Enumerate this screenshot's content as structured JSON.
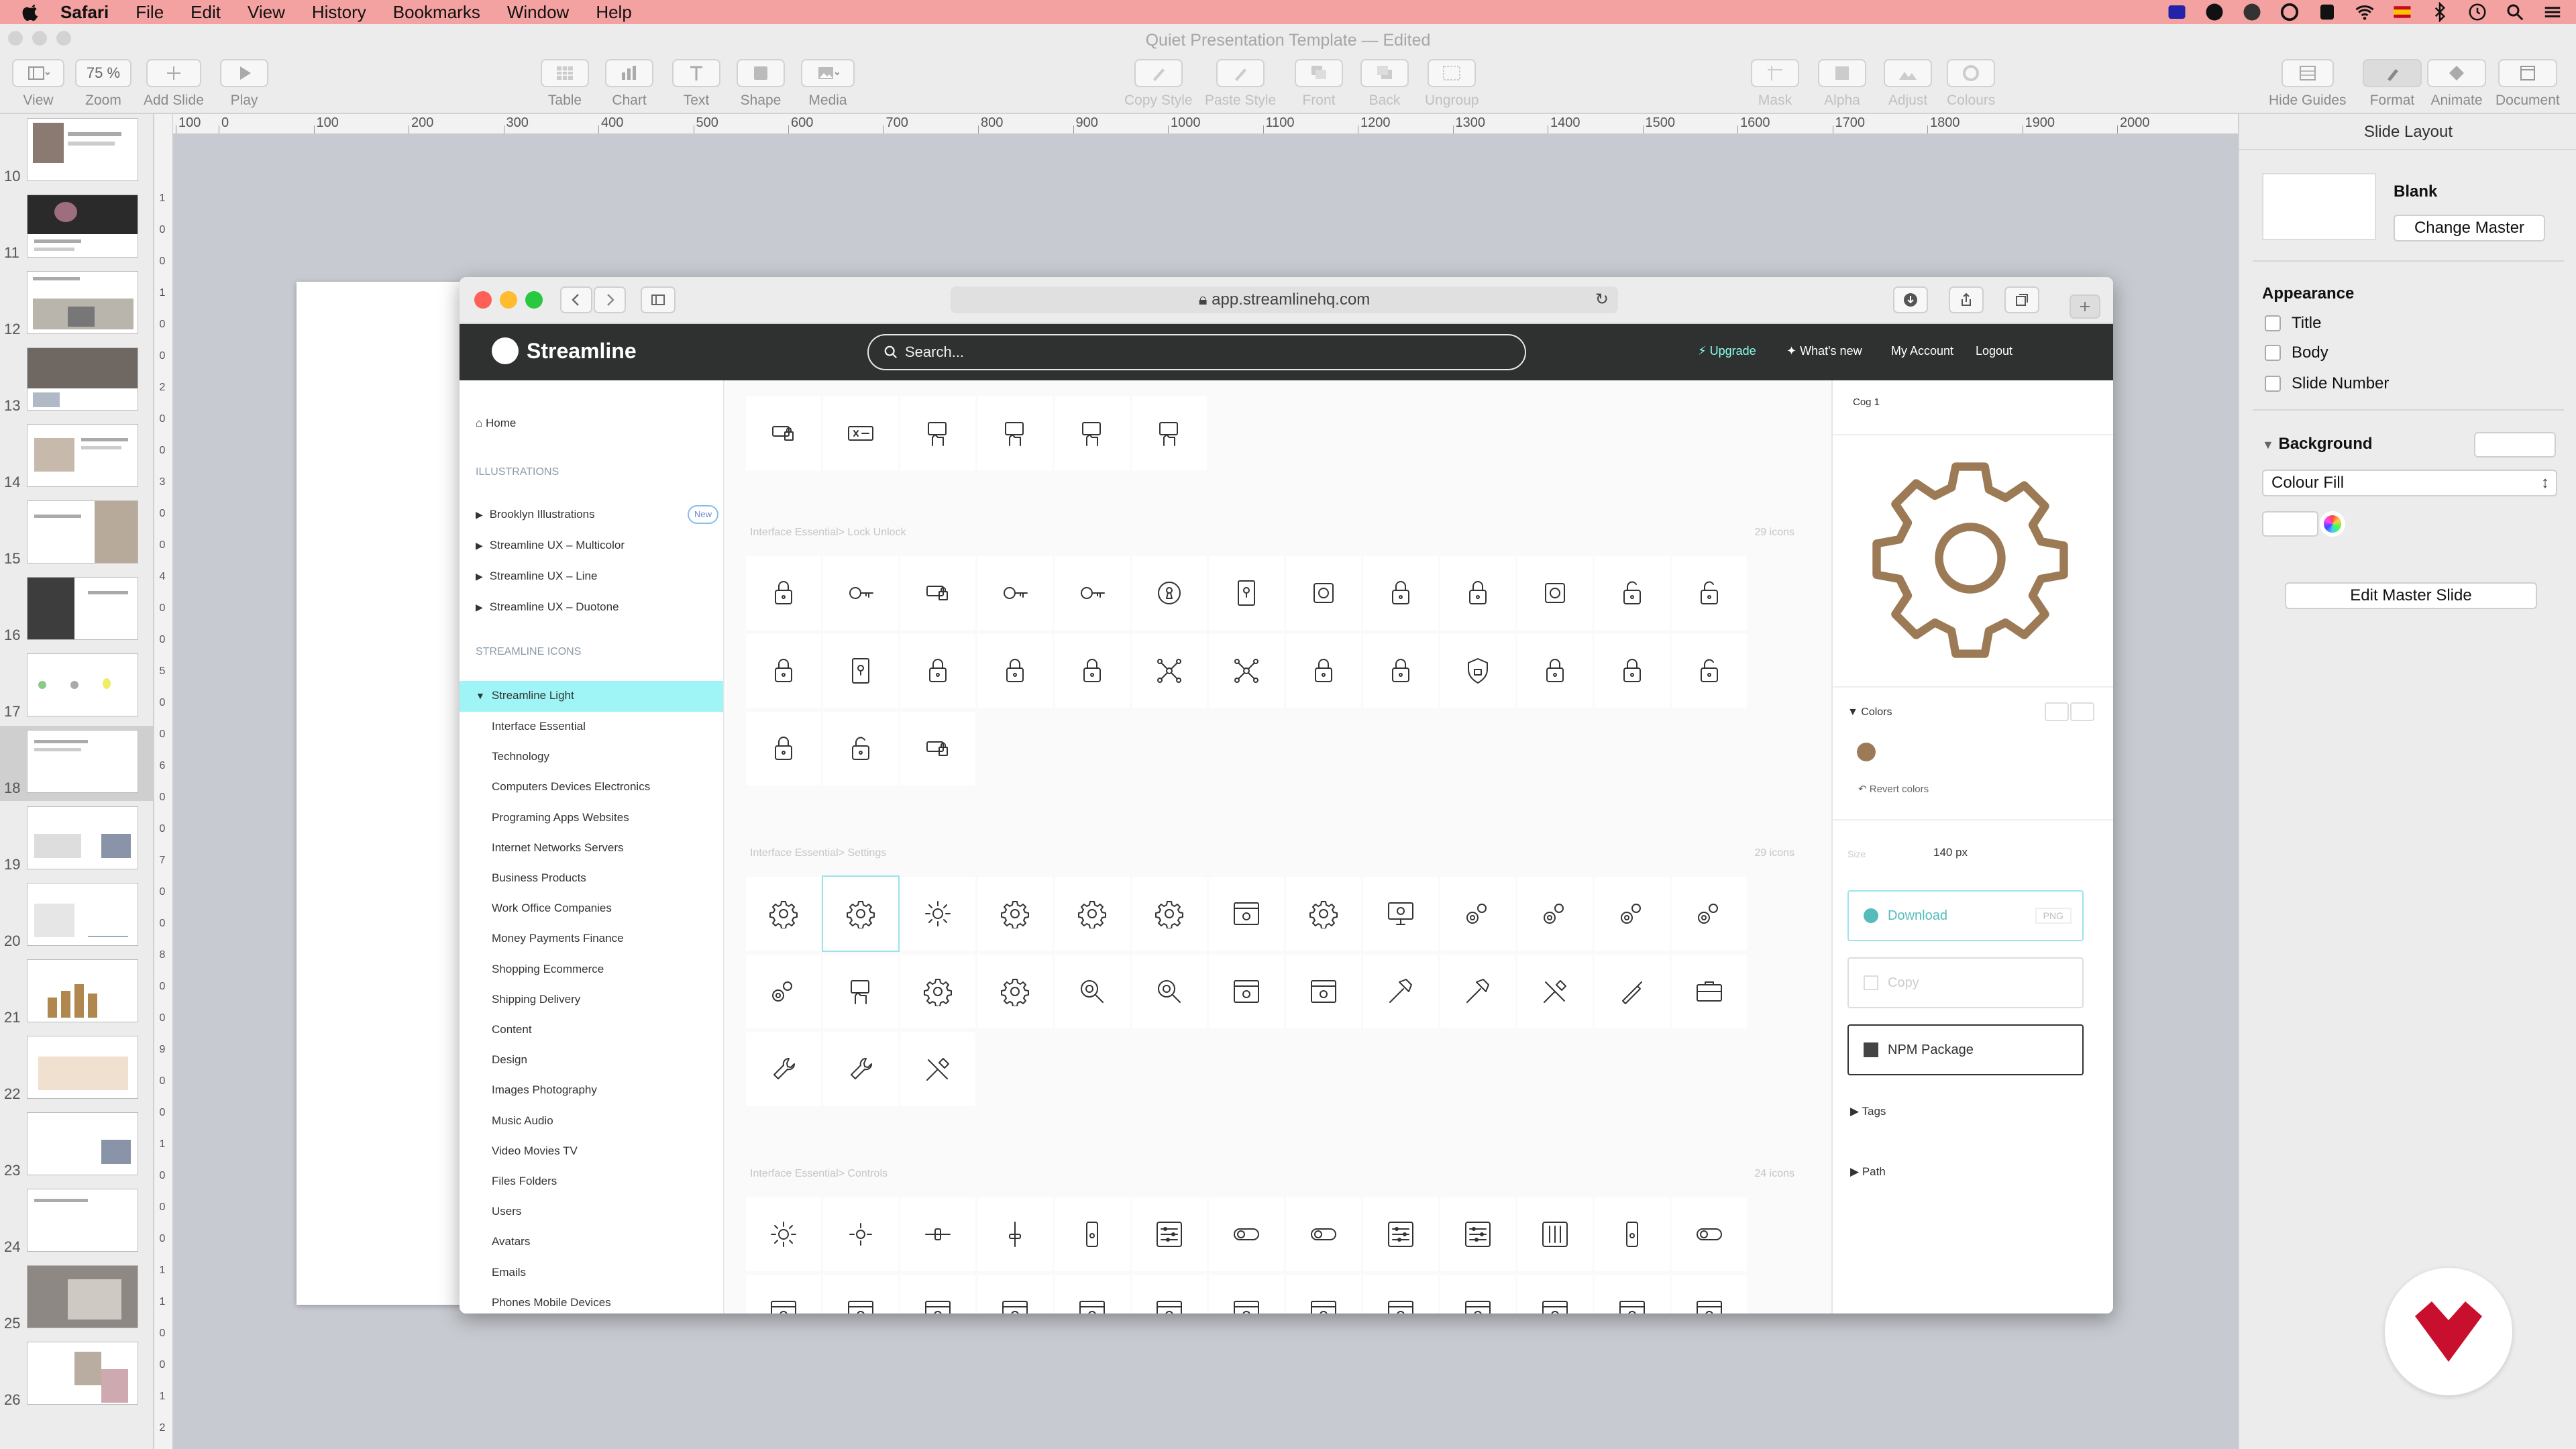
{
  "menubar": {
    "app": "Safari",
    "items": [
      "File",
      "Edit",
      "View",
      "History",
      "Bookmarks",
      "Window",
      "Help"
    ]
  },
  "keynote": {
    "doc_title": "Quiet Presentation Template — Edited",
    "zoom_value": "75 %",
    "toolbar": {
      "view": "View",
      "zoom": "Zoom",
      "add_slide": "Add Slide",
      "play": "Play",
      "table": "Table",
      "chart": "Chart",
      "text": "Text",
      "shape": "Shape",
      "media": "Media",
      "copy_style": "Copy Style",
      "paste_style": "Paste Style",
      "front": "Front",
      "back": "Back",
      "ungroup": "Ungroup",
      "mask": "Mask",
      "alpha": "Alpha",
      "adjust": "Adjust",
      "colours": "Colours",
      "hide_guides": "Hide Guides",
      "format": "Format",
      "animate": "Animate",
      "document": "Document"
    },
    "slide_numbers": [
      "10",
      "11",
      "12",
      "13",
      "14",
      "15",
      "16",
      "17",
      "18",
      "19",
      "20",
      "21",
      "22",
      "23",
      "24",
      "25",
      "26"
    ],
    "selected_slide": "18",
    "ruler_labels": [
      "100",
      "0",
      "100",
      "200",
      "300",
      "400",
      "500",
      "600",
      "700",
      "800",
      "900",
      "1000",
      "1100",
      "1200",
      "1300",
      "1400",
      "1500",
      "1600",
      "1700",
      "1800",
      "1900",
      "2000"
    ],
    "vruler_labels": [
      "1",
      "0",
      "0",
      "1",
      "0",
      "0",
      "2",
      "0",
      "0",
      "3",
      "0",
      "0",
      "4",
      "0",
      "0",
      "5",
      "0",
      "0",
      "6",
      "0",
      "0",
      "7",
      "0",
      "0",
      "8",
      "0",
      "0",
      "9",
      "0",
      "0",
      "1",
      "0",
      "0",
      "0",
      "1",
      "1",
      "0",
      "0",
      "1",
      "2"
    ],
    "inspector": {
      "header": "Slide Layout",
      "master_name": "Blank",
      "change_master": "Change Master",
      "appearance": "Appearance",
      "opt_title": "Title",
      "opt_body": "Body",
      "opt_slide_number": "Slide Number",
      "background": "Background",
      "fill_type": "Colour Fill",
      "edit_master": "Edit Master Slide"
    }
  },
  "browser": {
    "url": "app.streamlinehq.com"
  },
  "streamline": {
    "brand": "Streamline",
    "search_placeholder": "Search...",
    "header_links": {
      "upgrade": "Upgrade",
      "whats_new": "What's new",
      "my_account": "My Account",
      "logout": "Logout"
    },
    "nav": {
      "home": "Home",
      "illustrations_caption": "ILLUSTRATIONS",
      "illustrations": [
        "Brooklyn Illustrations",
        "Streamline UX – Multicolor",
        "Streamline UX – Line",
        "Streamline UX – Duotone"
      ],
      "new_badge": "New",
      "icons_caption": "STREAMLINE ICONS",
      "selected_set": "Streamline Light",
      "categories": [
        "Interface Essential",
        "Technology",
        "Computers Devices Electronics",
        "Programing Apps Websites",
        "Internet Networks Servers",
        "Business Products",
        "Work Office Companies",
        "Money Payments Finance",
        "Shopping Ecommerce",
        "Shipping Delivery",
        "Content",
        "Design",
        "Images Photography",
        "Music Audio",
        "Video Movies TV",
        "Files Folders",
        "Users",
        "Avatars",
        "Emails",
        "Phones Mobile Devices"
      ]
    },
    "sections": [
      {
        "title": "Interface Essential> Lock Unlock",
        "count": "29 icons"
      },
      {
        "title": "Interface Essential> Settings",
        "count": "29 icons"
      },
      {
        "title": "Interface Essential> Controls",
        "count": "24 icons"
      }
    ],
    "detail": {
      "icon_name": "Cog 1",
      "colors_label": "Colors",
      "icon_color": "#9b7a55",
      "revert": "Revert colors",
      "size_label": "Size",
      "size_value": "140 px",
      "download": "Download",
      "format": "PNG",
      "copy": "Copy",
      "npm": "NPM Package",
      "tags": "Tags",
      "path": "Path"
    }
  }
}
